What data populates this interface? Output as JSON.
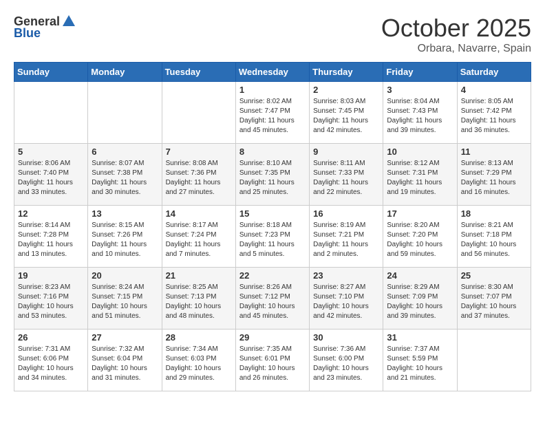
{
  "logo": {
    "general": "General",
    "blue": "Blue"
  },
  "header": {
    "month": "October 2025",
    "location": "Orbara, Navarre, Spain"
  },
  "weekdays": [
    "Sunday",
    "Monday",
    "Tuesday",
    "Wednesday",
    "Thursday",
    "Friday",
    "Saturday"
  ],
  "weeks": [
    [
      {
        "day": "",
        "sunrise": "",
        "sunset": "",
        "daylight": ""
      },
      {
        "day": "",
        "sunrise": "",
        "sunset": "",
        "daylight": ""
      },
      {
        "day": "",
        "sunrise": "",
        "sunset": "",
        "daylight": ""
      },
      {
        "day": "1",
        "sunrise": "Sunrise: 8:02 AM",
        "sunset": "Sunset: 7:47 PM",
        "daylight": "Daylight: 11 hours and 45 minutes."
      },
      {
        "day": "2",
        "sunrise": "Sunrise: 8:03 AM",
        "sunset": "Sunset: 7:45 PM",
        "daylight": "Daylight: 11 hours and 42 minutes."
      },
      {
        "day": "3",
        "sunrise": "Sunrise: 8:04 AM",
        "sunset": "Sunset: 7:43 PM",
        "daylight": "Daylight: 11 hours and 39 minutes."
      },
      {
        "day": "4",
        "sunrise": "Sunrise: 8:05 AM",
        "sunset": "Sunset: 7:42 PM",
        "daylight": "Daylight: 11 hours and 36 minutes."
      }
    ],
    [
      {
        "day": "5",
        "sunrise": "Sunrise: 8:06 AM",
        "sunset": "Sunset: 7:40 PM",
        "daylight": "Daylight: 11 hours and 33 minutes."
      },
      {
        "day": "6",
        "sunrise": "Sunrise: 8:07 AM",
        "sunset": "Sunset: 7:38 PM",
        "daylight": "Daylight: 11 hours and 30 minutes."
      },
      {
        "day": "7",
        "sunrise": "Sunrise: 8:08 AM",
        "sunset": "Sunset: 7:36 PM",
        "daylight": "Daylight: 11 hours and 27 minutes."
      },
      {
        "day": "8",
        "sunrise": "Sunrise: 8:10 AM",
        "sunset": "Sunset: 7:35 PM",
        "daylight": "Daylight: 11 hours and 25 minutes."
      },
      {
        "day": "9",
        "sunrise": "Sunrise: 8:11 AM",
        "sunset": "Sunset: 7:33 PM",
        "daylight": "Daylight: 11 hours and 22 minutes."
      },
      {
        "day": "10",
        "sunrise": "Sunrise: 8:12 AM",
        "sunset": "Sunset: 7:31 PM",
        "daylight": "Daylight: 11 hours and 19 minutes."
      },
      {
        "day": "11",
        "sunrise": "Sunrise: 8:13 AM",
        "sunset": "Sunset: 7:29 PM",
        "daylight": "Daylight: 11 hours and 16 minutes."
      }
    ],
    [
      {
        "day": "12",
        "sunrise": "Sunrise: 8:14 AM",
        "sunset": "Sunset: 7:28 PM",
        "daylight": "Daylight: 11 hours and 13 minutes."
      },
      {
        "day": "13",
        "sunrise": "Sunrise: 8:15 AM",
        "sunset": "Sunset: 7:26 PM",
        "daylight": "Daylight: 11 hours and 10 minutes."
      },
      {
        "day": "14",
        "sunrise": "Sunrise: 8:17 AM",
        "sunset": "Sunset: 7:24 PM",
        "daylight": "Daylight: 11 hours and 7 minutes."
      },
      {
        "day": "15",
        "sunrise": "Sunrise: 8:18 AM",
        "sunset": "Sunset: 7:23 PM",
        "daylight": "Daylight: 11 hours and 5 minutes."
      },
      {
        "day": "16",
        "sunrise": "Sunrise: 8:19 AM",
        "sunset": "Sunset: 7:21 PM",
        "daylight": "Daylight: 11 hours and 2 minutes."
      },
      {
        "day": "17",
        "sunrise": "Sunrise: 8:20 AM",
        "sunset": "Sunset: 7:20 PM",
        "daylight": "Daylight: 10 hours and 59 minutes."
      },
      {
        "day": "18",
        "sunrise": "Sunrise: 8:21 AM",
        "sunset": "Sunset: 7:18 PM",
        "daylight": "Daylight: 10 hours and 56 minutes."
      }
    ],
    [
      {
        "day": "19",
        "sunrise": "Sunrise: 8:23 AM",
        "sunset": "Sunset: 7:16 PM",
        "daylight": "Daylight: 10 hours and 53 minutes."
      },
      {
        "day": "20",
        "sunrise": "Sunrise: 8:24 AM",
        "sunset": "Sunset: 7:15 PM",
        "daylight": "Daylight: 10 hours and 51 minutes."
      },
      {
        "day": "21",
        "sunrise": "Sunrise: 8:25 AM",
        "sunset": "Sunset: 7:13 PM",
        "daylight": "Daylight: 10 hours and 48 minutes."
      },
      {
        "day": "22",
        "sunrise": "Sunrise: 8:26 AM",
        "sunset": "Sunset: 7:12 PM",
        "daylight": "Daylight: 10 hours and 45 minutes."
      },
      {
        "day": "23",
        "sunrise": "Sunrise: 8:27 AM",
        "sunset": "Sunset: 7:10 PM",
        "daylight": "Daylight: 10 hours and 42 minutes."
      },
      {
        "day": "24",
        "sunrise": "Sunrise: 8:29 AM",
        "sunset": "Sunset: 7:09 PM",
        "daylight": "Daylight: 10 hours and 39 minutes."
      },
      {
        "day": "25",
        "sunrise": "Sunrise: 8:30 AM",
        "sunset": "Sunset: 7:07 PM",
        "daylight": "Daylight: 10 hours and 37 minutes."
      }
    ],
    [
      {
        "day": "26",
        "sunrise": "Sunrise: 7:31 AM",
        "sunset": "Sunset: 6:06 PM",
        "daylight": "Daylight: 10 hours and 34 minutes."
      },
      {
        "day": "27",
        "sunrise": "Sunrise: 7:32 AM",
        "sunset": "Sunset: 6:04 PM",
        "daylight": "Daylight: 10 hours and 31 minutes."
      },
      {
        "day": "28",
        "sunrise": "Sunrise: 7:34 AM",
        "sunset": "Sunset: 6:03 PM",
        "daylight": "Daylight: 10 hours and 29 minutes."
      },
      {
        "day": "29",
        "sunrise": "Sunrise: 7:35 AM",
        "sunset": "Sunset: 6:01 PM",
        "daylight": "Daylight: 10 hours and 26 minutes."
      },
      {
        "day": "30",
        "sunrise": "Sunrise: 7:36 AM",
        "sunset": "Sunset: 6:00 PM",
        "daylight": "Daylight: 10 hours and 23 minutes."
      },
      {
        "day": "31",
        "sunrise": "Sunrise: 7:37 AM",
        "sunset": "Sunset: 5:59 PM",
        "daylight": "Daylight: 10 hours and 21 minutes."
      },
      {
        "day": "",
        "sunrise": "",
        "sunset": "",
        "daylight": ""
      }
    ]
  ]
}
